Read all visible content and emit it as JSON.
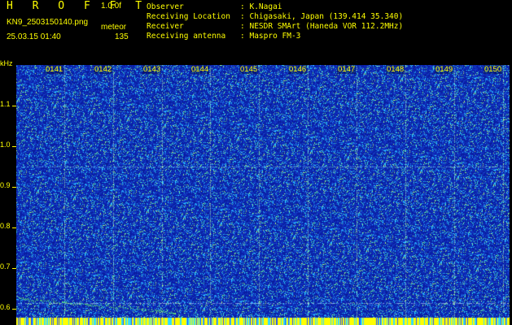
{
  "header": {
    "app_title": "H R O F F T",
    "version": "1.0.0f",
    "filename": "KN9_2503150140.png",
    "mode": "meteor",
    "datetime": "25.03.15 01:40",
    "count": "135"
  },
  "info": [
    {
      "key": "Observer",
      "sep": ":",
      "value": "K.Nagai"
    },
    {
      "key": "Receiving Location",
      "sep": ":",
      "value": "Chigasaki, Japan (139.414 35.340)"
    },
    {
      "key": "Receiver",
      "sep": ":",
      "value": "NESDR SMArt (Haneda VOR 112.2MHz)"
    },
    {
      "key": "Receiving antenna",
      "sep": ":",
      "value": "Maspro FM-3"
    }
  ],
  "y_axis": {
    "unit": "kHz",
    "labels": [
      "1.1",
      "1.0",
      "0.9",
      "0.8",
      "0.7",
      "0.6"
    ]
  },
  "time_labels": [
    "0141",
    "0142",
    "0143",
    "0144",
    "0145",
    "0146",
    "0147",
    "0148",
    "0149",
    "0150"
  ],
  "colors": {
    "background": "#000000",
    "text": "#ffff00",
    "waterfall_base": "#0a1f9e",
    "noise_light": "#39c6ff",
    "noise_green": "#5cff5c",
    "bottom_band": "#ffff00"
  }
}
